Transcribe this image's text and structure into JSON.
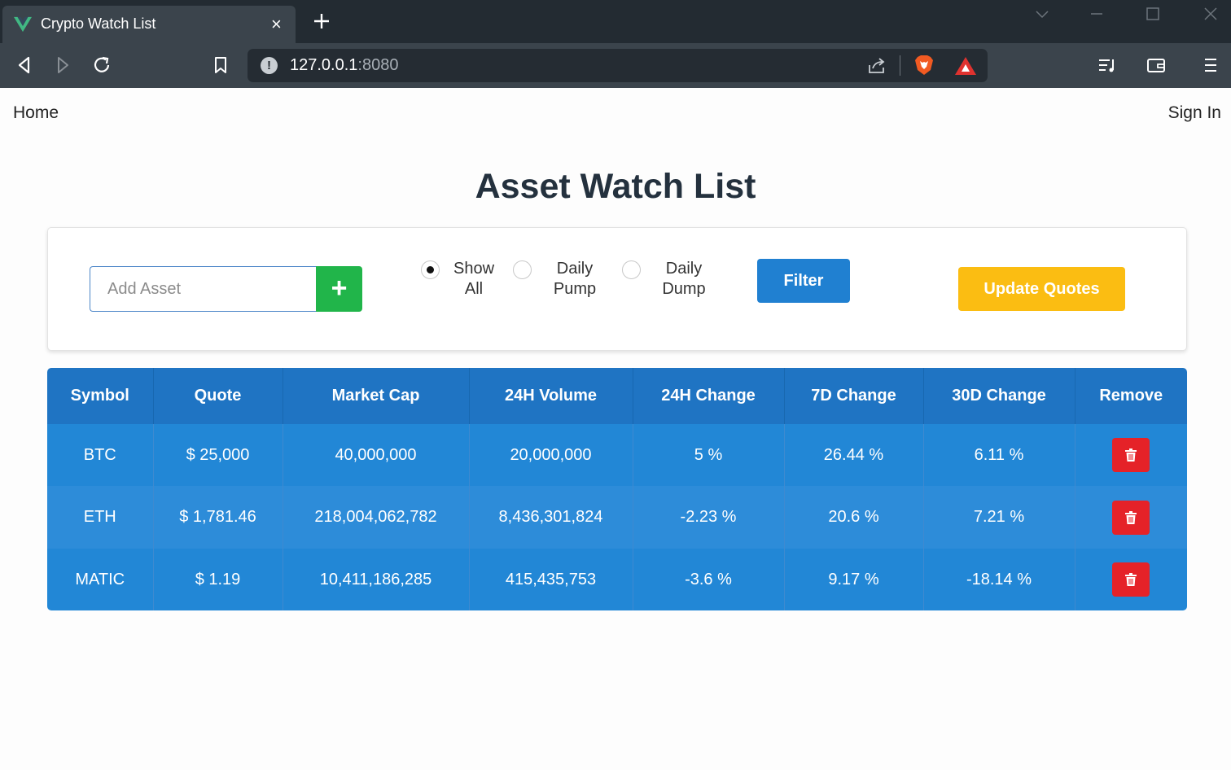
{
  "browser": {
    "tab_title": "Crypto Watch List",
    "tab_close": "×",
    "url_host": "127.0.0.1",
    "url_port": ":8080",
    "info_glyph": "!"
  },
  "nav": {
    "home": "Home",
    "sign_in": "Sign In"
  },
  "page_title": "Asset Watch List",
  "controls": {
    "add_asset_placeholder": "Add Asset",
    "add_button": "+",
    "filters": [
      {
        "line1": "Show",
        "line2": "All",
        "checked": true
      },
      {
        "line1": "Daily",
        "line2": "Pump",
        "checked": false
      },
      {
        "line1": "Daily",
        "line2": "Dump",
        "checked": false
      }
    ],
    "filter_button": "Filter",
    "update_button": "Update Quotes"
  },
  "table": {
    "headers": [
      "Symbol",
      "Quote",
      "Market Cap",
      "24H Volume",
      "24H Change",
      "7D Change",
      "30D Change",
      "Remove"
    ],
    "rows": [
      {
        "symbol": "BTC",
        "quote": "$ 25,000",
        "market_cap": "40,000,000",
        "volume_24h": "20,000,000",
        "change_24h": "5 %",
        "change_7d": "26.44 %",
        "change_30d": "6.11 %"
      },
      {
        "symbol": "ETH",
        "quote": "$ 1,781.46",
        "market_cap": "218,004,062,782",
        "volume_24h": "8,436,301,824",
        "change_24h": "-2.23 %",
        "change_7d": "20.6 %",
        "change_30d": "7.21 %"
      },
      {
        "symbol": "MATIC",
        "quote": "$ 1.19",
        "market_cap": "10,411,186,285",
        "volume_24h": "415,435,753",
        "change_24h": "-3.6 %",
        "change_7d": "9.17 %",
        "change_30d": "-18.14 %"
      }
    ]
  },
  "colors": {
    "table_header": "#1f74c3",
    "table_row": "#2287d6",
    "add_green": "#21b54a",
    "filter_blue": "#2080d1",
    "update_yellow": "#fbbd12",
    "delete_red": "#e52228"
  },
  "icons": [
    "vue-logo-icon",
    "close-icon",
    "plus-icon",
    "back-icon",
    "forward-icon",
    "reload-icon",
    "bookmark-icon",
    "info-icon",
    "share-icon",
    "brave-shield-icon",
    "brave-rewards-icon",
    "playlist-icon",
    "wallet-icon",
    "menu-icon",
    "trash-icon"
  ]
}
